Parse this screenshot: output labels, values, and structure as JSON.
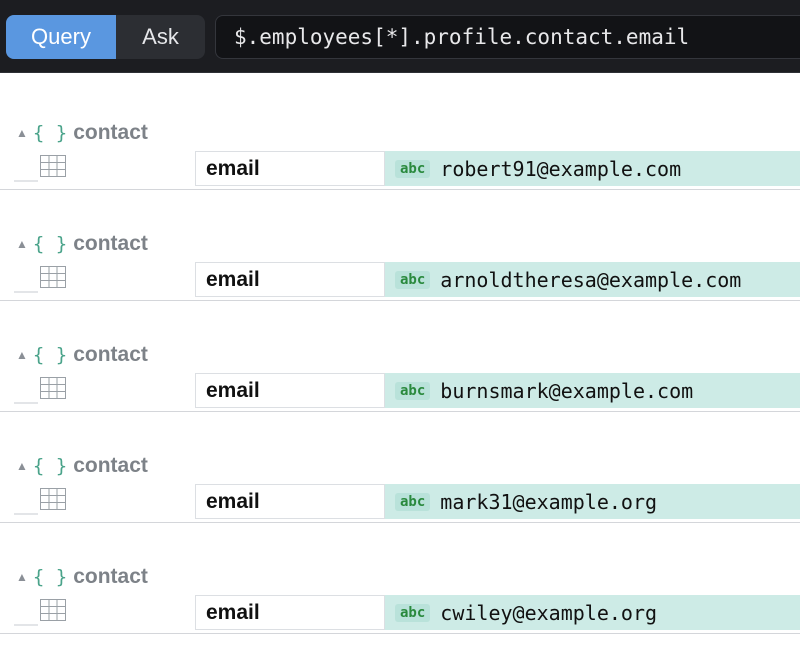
{
  "toolbar": {
    "query_label": "Query",
    "ask_label": "Ask",
    "query_text": "$.employees[*].profile.contact.email"
  },
  "results": {
    "records": [
      {
        "key": "contact",
        "field": "email",
        "type": "abc",
        "value": "robert91@example.com"
      },
      {
        "key": "contact",
        "field": "email",
        "type": "abc",
        "value": "arnoldtheresa@example.com"
      },
      {
        "key": "contact",
        "field": "email",
        "type": "abc",
        "value": "burnsmark@example.com"
      },
      {
        "key": "contact",
        "field": "email",
        "type": "abc",
        "value": "mark31@example.org"
      },
      {
        "key": "contact",
        "field": "email",
        "type": "abc",
        "value": "cwiley@example.org"
      }
    ]
  },
  "icons": {
    "caret": "caret-up-icon",
    "object": "braces-icon",
    "table": "table-icon"
  },
  "colors": {
    "active_tab": "#5a97e0",
    "value_bg": "#cdebe6",
    "type_badge": "#2a8a3e",
    "brace": "#4aa38a"
  }
}
